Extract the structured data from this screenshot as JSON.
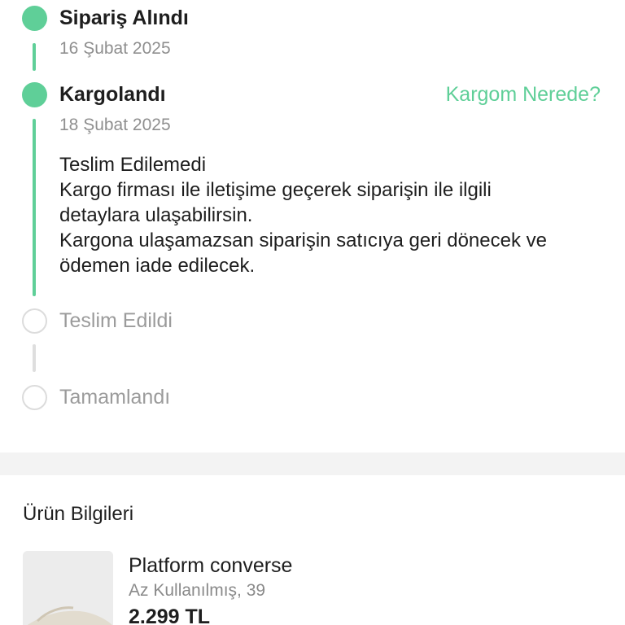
{
  "timeline": {
    "steps": [
      {
        "title": "Sipariş Alındı",
        "date": "16 Şubat 2025",
        "status": "done"
      },
      {
        "title": "Kargolandı",
        "date": "18 Şubat 2025",
        "status": "done"
      },
      {
        "title": "Teslim Edildi",
        "status": "pending"
      },
      {
        "title": "Tamamlandı",
        "status": "pending"
      }
    ],
    "tracking_link": "Kargom Nerede?",
    "status_message": {
      "heading": "Teslim Edilemedi",
      "lines": [
        "Kargo firması ile iletişime geçerek siparişin ile ilgili",
        "detaylara ulaşabilirsin.",
        "Kargona ulaşamazsan siparişin satıcıya geri dönecek ve",
        "ödemen iade edilecek."
      ]
    }
  },
  "product_section": {
    "title": "Ürün Bilgileri",
    "product": {
      "name": "Platform converse",
      "meta": "Az Kullanılmış, 39",
      "price": "2.299 TL"
    }
  },
  "colors": {
    "accent": "#5fcf98",
    "pending": "#dcdcdc",
    "muted_text": "#8f8f8f"
  }
}
